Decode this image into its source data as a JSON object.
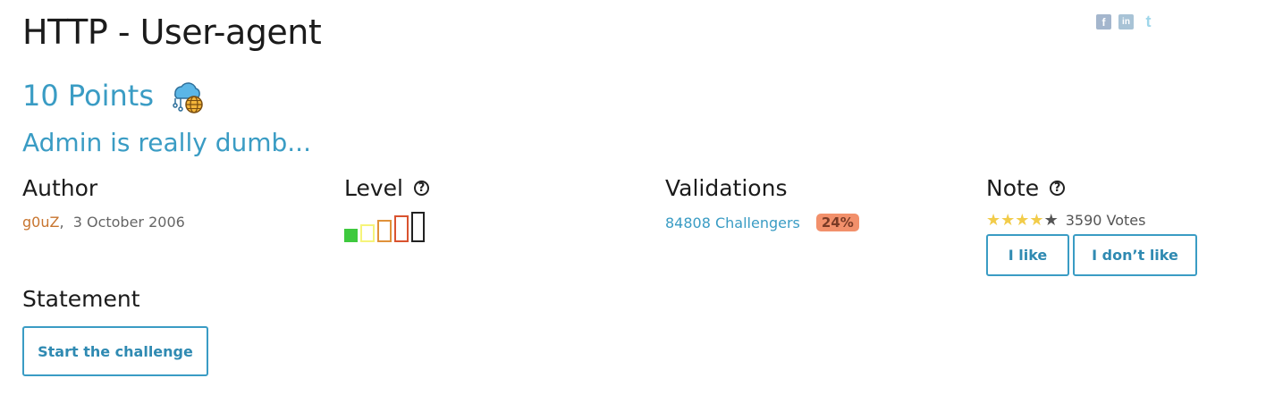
{
  "challenge": {
    "title": "HTTP - User-agent",
    "points": "10 Points",
    "category_icon": "web-server-icon",
    "subtitle": "Admin is really dumb..."
  },
  "social": {
    "icons": [
      "facebook-icon",
      "linkedin-icon",
      "twitter-icon"
    ],
    "facebook": "f",
    "linkedin": "in",
    "twitter": "t"
  },
  "author": {
    "heading": "Author",
    "name": "g0uZ",
    "separator": ",",
    "date": "3 October 2006"
  },
  "level": {
    "heading": "Level",
    "help": "?",
    "current_level": 1,
    "max_level": 5,
    "colors": [
      "#3ec93e",
      "#f6f47a",
      "#e0913a",
      "#d9532f",
      "#222222"
    ]
  },
  "validations": {
    "heading": "Validations",
    "challengers": "84808 Challengers",
    "percent": "24%"
  },
  "note": {
    "heading": "Note",
    "help": "?",
    "rating": 4,
    "max_rating": 5,
    "votes": "3590 Votes",
    "like_label": "I like",
    "dislike_label": "I don’t like"
  },
  "statement": {
    "heading": "Statement",
    "start_label": "Start the challenge"
  }
}
